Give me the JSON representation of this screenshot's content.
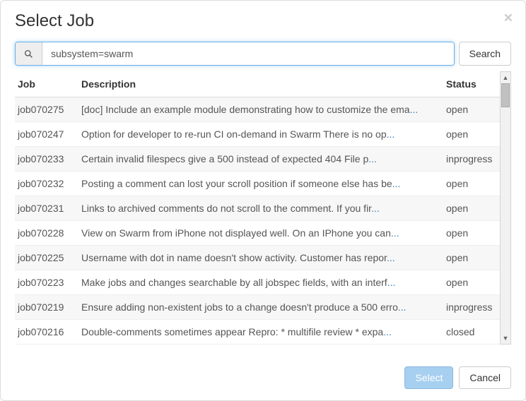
{
  "title": "Select Job",
  "search": {
    "value": "subsystem=swarm",
    "button": "Search"
  },
  "columns": {
    "job": "Job",
    "description": "Description",
    "status": "Status"
  },
  "rows": [
    {
      "job": "job070275",
      "desc": "[doc] Include an example module demonstrating how to customize the ema",
      "status": "open"
    },
    {
      "job": "job070247",
      "desc": "Option for developer to re-run CI on-demand in Swarm There is no op",
      "status": "open"
    },
    {
      "job": "job070233",
      "desc": "Certain invalid filespecs give a 500 instead of expected 404 File p",
      "status": "inprogress"
    },
    {
      "job": "job070232",
      "desc": "Posting a comment can lost your scroll position if someone else has be",
      "status": "open"
    },
    {
      "job": "job070231",
      "desc": "Links to archived comments do not scroll to the comment. If you fir",
      "status": "open"
    },
    {
      "job": "job070228",
      "desc": "View on Swarm from iPhone not displayed well. On an IPhone you can",
      "status": "open"
    },
    {
      "job": "job070225",
      "desc": "Username with dot in name doesn't show activity. Customer has repor",
      "status": "open"
    },
    {
      "job": "job070223",
      "desc": "Make jobs and changes searchable by all jobspec fields, with an interf",
      "status": "open"
    },
    {
      "job": "job070219",
      "desc": "Ensure adding non-existent jobs to a change doesn't produce a 500 erro",
      "status": "inprogress"
    },
    {
      "job": "job070216",
      "desc": "Double-comments sometimes appear Repro: * multifile review * expa",
      "status": "closed"
    }
  ],
  "footer": {
    "select": "Select",
    "cancel": "Cancel"
  }
}
